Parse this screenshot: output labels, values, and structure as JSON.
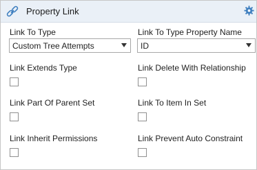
{
  "header": {
    "title": "Property Link",
    "icon": "link-chain-icon",
    "settings_icon": "gear-icon"
  },
  "fields": {
    "link_to_type": {
      "label": "Link To Type",
      "value": "Custom Tree Attempts"
    },
    "link_to_type_property_name": {
      "label": "Link To Type Property Name",
      "value": "ID"
    }
  },
  "checkboxes": [
    {
      "label": "Link Extends Type",
      "checked": false
    },
    {
      "label": "Link Delete With Relationship",
      "checked": false
    },
    {
      "label": "Link Part Of Parent Set",
      "checked": false
    },
    {
      "label": "Link To Item In Set",
      "checked": false
    },
    {
      "label": "Link Inherit Permissions",
      "checked": false
    },
    {
      "label": "Link Prevent Auto Constraint",
      "checked": false
    }
  ],
  "colors": {
    "header_bg": "#eaf0f7",
    "icon_blue": "#3f7fbf"
  }
}
